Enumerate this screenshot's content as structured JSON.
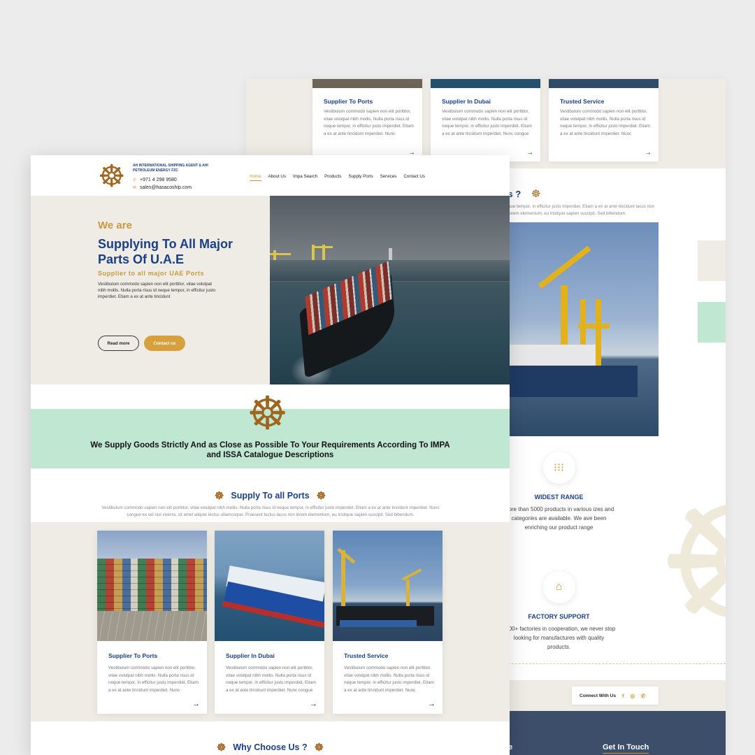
{
  "back": {
    "cards": [
      {
        "title": "Supplier To Ports",
        "text": "Vestibulum commodo sapien non elit porttitor, vitae volutpat nibh mollis. Nulla porta risus id neque tempor, in efficitur justo imperdiet. Etiam a ex at ante tincidunt imperdiet. Nunc",
        "arrow": "→"
      },
      {
        "title": "Supplier In Dubai",
        "text": "Vestibulum commodo sapien non elit porttitor, vitae volutpat nibh mollis. Nulla porta risus id neque tempor, in efficitur justo imperdiet. Etiam a ex at ante tincidunt imperdiet. Nunc congue",
        "arrow": "→"
      },
      {
        "title": "Trusted Service",
        "text": "Vestibulum commodo sapien non elit porttitor, vitae volutpat nibh mollis. Nulla porta risus id neque tempor, in efficitur justo imperdiet. Etiam a ex at ante tincidunt imperdiet. Nunc",
        "arrow": "→"
      }
    ],
    "why_title_partial": "Us ?",
    "why_text": "aue tempor, in efficitur justo imperdiet. Etiam a ex at ante tincidunt lacus non lorem elementum, eu tristique sapien suscipit. Sed bibendum.",
    "features": [
      {
        "title": "WIDEST RANGE",
        "text": "More than 5000 products in various izes and categories are available. We ave been enriching our product range",
        "icon": "grid-icon"
      },
      {
        "title": "FACTORY SUPPORT",
        "text": "1000+ factories in cooperation, we never stop looking for manufactures with quality products.",
        "icon": "factory-icon"
      }
    ],
    "connect_label": "Connect With Us",
    "footer": {
      "get_in_touch": "Get In Touch",
      "partial": "e"
    }
  },
  "header": {
    "company_name": "AH INTERNATIONAL SHIPPING AGENT & AHI PETROLEUM ENERGY FZC",
    "phone": "+971 4 298 9580",
    "email": "sales@hasacoship.com",
    "nav": [
      "Home",
      "About Us",
      "Impa Search",
      "Products",
      "Supply Ports",
      "Services",
      "Contact Us"
    ],
    "active_nav": "Home"
  },
  "hero": {
    "kicker": "We are",
    "title": "Supplying To All Major Parts Of U.A.E",
    "subtitle": "Supplier to all major UAE Ports",
    "text": "Vestibulum commodo sapien non elit porttitor, vitae volutpat nibh mollis. Nulla porta risus id neque tempor, in efficitur justo imperdiet. Etiam a ex at ante tincidunt",
    "btn_read_more": "Read more",
    "btn_contact": "Contact us"
  },
  "band": {
    "text": "We Supply Goods Strictly And as Close as Possible To Your Requirements According To IMPA and ISSA Catalogue Descriptions"
  },
  "supply": {
    "title": "Supply To all Ports",
    "text": "Vestibulum commodo sapien non elit porttitor, vitae volutpat nibh mollis. Nulla porta risus id neque tempor, in efficitur justo imperdiet. Etiam a ex at ante tincidunt imperdiet. Nunc congue ex vel nisl viverra, sit amet aliquet lectus ullamcorper. Praesent luctus lacus non lorem elementum, eu tristique sapien suscipit. Sed bibendum.",
    "cards": [
      {
        "title": "Supplier To Ports",
        "text": "Vestibulum commodo sapien non elit porttitor, vitae volutpat nibh mollis. Nulla porta risus id neque tempor, in efficitur justo imperdiet. Etiam a ex at ante tincidunt imperdiet. Nunc",
        "arrow": "→"
      },
      {
        "title": "Supplier In Dubai",
        "text": "Vestibulum commodo sapien non elit porttitor, vitae volutpat nibh mollis. Nulla porta risus id neque tempor, in efficitur justo imperdiet. Etiam a ex at ante tincidunt imperdiet. Nunc congue",
        "arrow": "→"
      },
      {
        "title": "Trusted Service",
        "text": "Vestibulum commodo sapien non elit porttitor, vitae volutpat nibh mollis. Nulla porta risus id neque tempor, in efficitur justo imperdiet. Etiam a ex at ante tincidunt imperdiet. Nunc",
        "arrow": "→"
      }
    ]
  },
  "why": {
    "title": "Why Choose Us ?"
  },
  "icons": {
    "wheel": "ship-wheel-icon",
    "phone": "phone-icon",
    "email": "email-icon",
    "arrow": "arrow-right-icon",
    "social": [
      "facebook-icon",
      "instagram-icon",
      "whatsapp-icon"
    ]
  },
  "colors": {
    "navy": "#1a3f86",
    "gold": "#c89a3c",
    "brown": "#a0661f",
    "mint": "#bfe7d1",
    "beige": "#eeece4",
    "footer": "#3d4e6a"
  }
}
